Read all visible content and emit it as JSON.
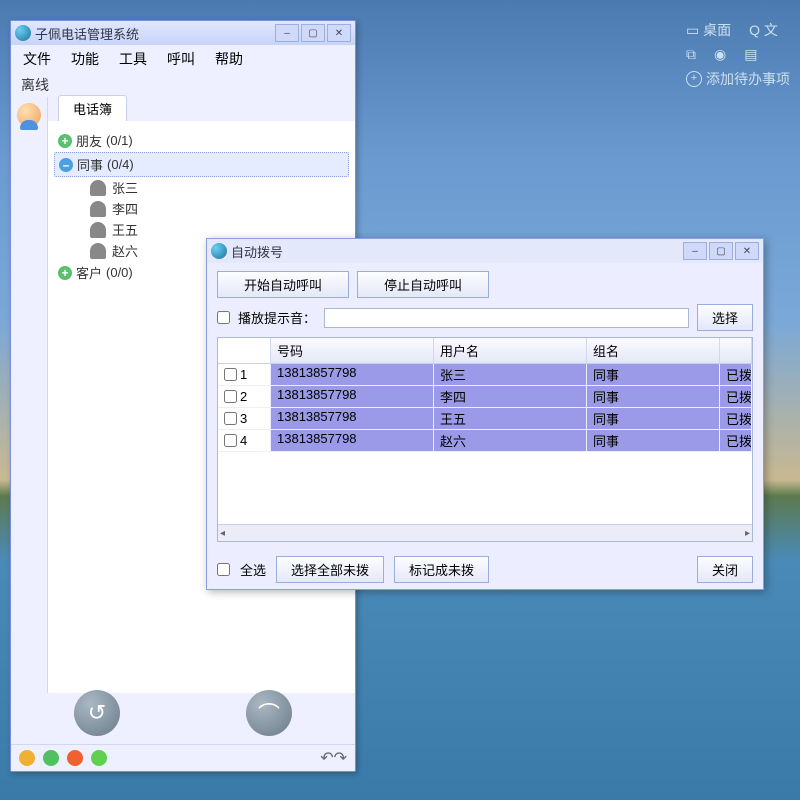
{
  "desktop": {
    "widgets": [
      "桌面",
      "文"
    ],
    "eye_row": [
      "",
      "",
      ""
    ],
    "add_todo": "添加待办事项"
  },
  "main_window": {
    "title": "子佩电话管理系统",
    "menu": [
      "文件",
      "功能",
      "工具",
      "呼叫",
      "帮助"
    ],
    "status": "离线",
    "tab": "电话簿",
    "groups": [
      {
        "label": "朋友",
        "count": "(0/1)",
        "expanded": false
      },
      {
        "label": "同事",
        "count": "(0/4)",
        "expanded": true,
        "selected": true,
        "contacts": [
          "张三",
          "李四",
          "王五",
          "赵六"
        ]
      },
      {
        "label": "客户",
        "count": "(0/0)",
        "expanded": false
      }
    ]
  },
  "dialog": {
    "title": "自动拨号",
    "btn_start": "开始自动呼叫",
    "btn_stop": "停止自动呼叫",
    "play_prompt_label": "播放提示音：",
    "btn_browse": "选择",
    "columns": {
      "num": "号码",
      "user": "用户名",
      "grp": "组名"
    },
    "rows": [
      {
        "idx": "1",
        "num": "13813857798",
        "user": "张三",
        "grp": "同事",
        "stat": "已拨"
      },
      {
        "idx": "2",
        "num": "13813857798",
        "user": "李四",
        "grp": "同事",
        "stat": "已拨"
      },
      {
        "idx": "3",
        "num": "13813857798",
        "user": "王五",
        "grp": "同事",
        "stat": "已拨"
      },
      {
        "idx": "4",
        "num": "13813857798",
        "user": "赵六",
        "grp": "同事",
        "stat": "已拨"
      }
    ],
    "select_all": "全选",
    "btn_select_undial": "选择全部未拨",
    "btn_mark_undial": "标记成未拨",
    "btn_close": "关闭"
  }
}
